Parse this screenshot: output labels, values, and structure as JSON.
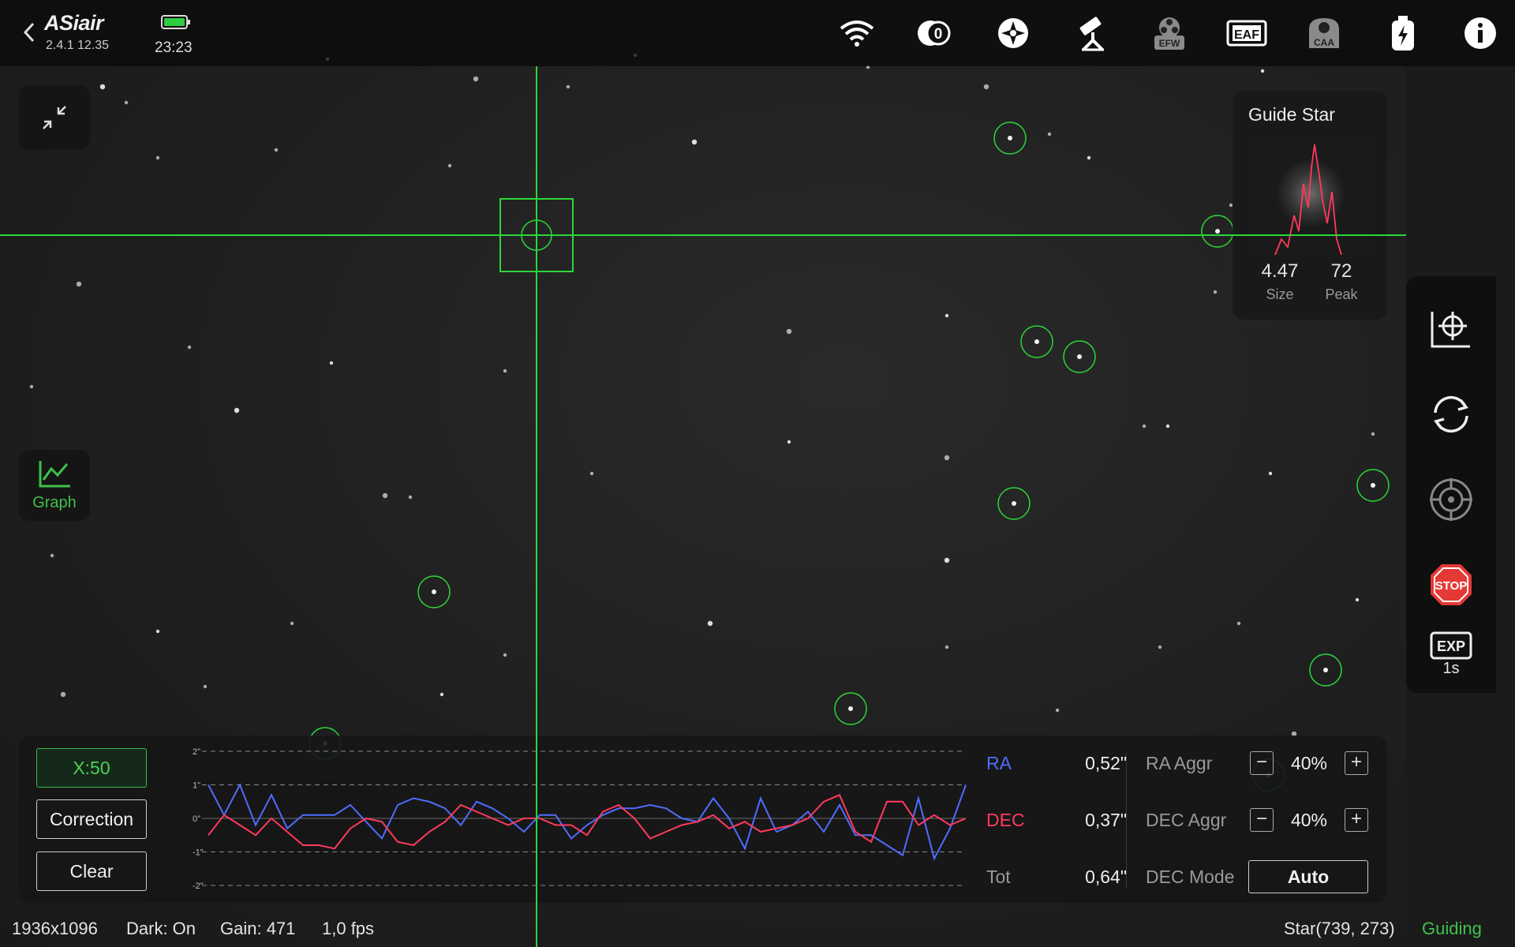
{
  "app": {
    "brand": "ASiair",
    "version": "2.4.1 12.35",
    "time": "23:23"
  },
  "topbar": {
    "icons": [
      "wifi-icon",
      "filter-wheel-zero-icon",
      "focus-target-icon",
      "telescope-mount-icon",
      "efw-icon",
      "eaf-icon",
      "caa-icon",
      "power-usb-icon",
      "info-icon"
    ],
    "efw_label": "EFW",
    "eaf_label": "EAF",
    "caa_label": "CAA",
    "zero_label": "0",
    "colors": {
      "battery": "#2ecc40",
      "inactive": "#8a8a8a"
    }
  },
  "left_buttons": {
    "graph_label": "Graph"
  },
  "guide_star": {
    "title": "Guide Star",
    "size_value": "4.47",
    "size_label": "Size",
    "peak_value": "72",
    "peak_label": "Peak"
  },
  "right_toolbar": {
    "exposure_label": "EXP",
    "exposure_value": "1s",
    "stop_label": "STOP"
  },
  "graph": {
    "x_scale": "X:50",
    "correction_label": "Correction",
    "clear_label": "Clear",
    "y_ticks": [
      "2\"",
      "1\"",
      "0\"",
      "-1\"",
      "-2\""
    ],
    "ra_label": "RA",
    "ra_value": "0,52\"",
    "dec_label": "DEC",
    "dec_value": "0,37\"",
    "tot_label": "Tot",
    "tot_value": "0,64\"",
    "ra_aggr_label": "RA Aggr",
    "ra_aggr_value": "40%",
    "dec_aggr_label": "DEC Aggr",
    "dec_aggr_value": "40%",
    "dec_mode_label": "DEC Mode",
    "dec_mode_value": "Auto",
    "colors": {
      "ra": "#4f6cff",
      "dec": "#ff3a5c"
    }
  },
  "chart_data": {
    "type": "line",
    "title": "",
    "ylim": [
      -2,
      2
    ],
    "y_unit": "arcsec",
    "series": [
      {
        "name": "RA",
        "values": [
          1,
          0.1,
          1,
          -0.2,
          0.7,
          -0.3,
          0.1,
          0.1,
          0.1,
          0.4,
          -0.1,
          -0.6,
          0.4,
          0.6,
          0.5,
          0.3,
          -0.2,
          0.5,
          0.3,
          0,
          -0.4,
          0.1,
          0.1,
          -0.6,
          -0.2,
          0.1,
          0.3,
          0.3,
          0.4,
          0.3,
          0,
          -0.1,
          0.6,
          0,
          -0.9,
          0.6,
          -0.4,
          -0.2,
          0.2,
          -0.4,
          0.4,
          -0.5,
          -0.5,
          -0.8,
          -1.1,
          0.6,
          -1.2,
          -0.3,
          1
        ]
      },
      {
        "name": "DEC",
        "values": [
          -0.5,
          0.1,
          -0.2,
          -0.5,
          0,
          -0.4,
          -0.8,
          -0.8,
          -0.9,
          -0.3,
          0,
          -0.1,
          -0.7,
          -0.8,
          -0.4,
          -0.1,
          0.4,
          0.2,
          0,
          -0.2,
          0,
          0,
          -0.2,
          -0.2,
          -0.5,
          0.2,
          0.4,
          0,
          -0.6,
          -0.4,
          -0.2,
          -0.1,
          0.1,
          -0.3,
          -0.1,
          -0.4,
          -0.3,
          -0.2,
          0,
          0.5,
          0.7,
          -0.4,
          -0.7,
          0.5,
          0.5,
          -0.2,
          0.1,
          -0.2,
          0
        ]
      }
    ]
  },
  "sky_field": {
    "stars": [
      [
        130,
        110
      ],
      [
        160,
        130
      ],
      [
        200,
        200
      ],
      [
        415,
        75
      ],
      [
        603,
        100
      ],
      [
        720,
        110
      ],
      [
        805,
        70
      ],
      [
        1100,
        85
      ],
      [
        1250,
        110
      ],
      [
        1600,
        90
      ],
      [
        350,
        190
      ],
      [
        570,
        210
      ],
      [
        880,
        180
      ],
      [
        1330,
        170
      ],
      [
        1560,
        260
      ],
      [
        1380,
        200
      ],
      [
        100,
        360
      ],
      [
        240,
        440
      ],
      [
        420,
        460
      ],
      [
        640,
        470
      ],
      [
        1000,
        420
      ],
      [
        1200,
        400
      ],
      [
        1540,
        370
      ],
      [
        40,
        490
      ],
      [
        300,
        520
      ],
      [
        520,
        630
      ],
      [
        750,
        600
      ],
      [
        1000,
        560
      ],
      [
        1200,
        580
      ],
      [
        1450,
        540
      ],
      [
        1610,
        600
      ],
      [
        1740,
        550
      ],
      [
        488,
        628
      ],
      [
        200,
        800
      ],
      [
        370,
        790
      ],
      [
        640,
        830
      ],
      [
        900,
        790
      ],
      [
        1200,
        820
      ],
      [
        1570,
        790
      ],
      [
        1720,
        760
      ],
      [
        80,
        880
      ],
      [
        260,
        870
      ],
      [
        560,
        880
      ],
      [
        1340,
        900
      ],
      [
        1640,
        930
      ],
      [
        1480,
        540
      ],
      [
        1470,
        820
      ],
      [
        66,
        704
      ],
      [
        1200,
        710
      ]
    ],
    "circles": [
      [
        1280,
        175
      ],
      [
        1543,
        293
      ],
      [
        1314,
        433
      ],
      [
        1368,
        452
      ],
      [
        1740,
        615
      ],
      [
        1285,
        638
      ],
      [
        550,
        750
      ],
      [
        1680,
        849
      ],
      [
        1078,
        898
      ],
      [
        412,
        942
      ],
      [
        1608,
        982
      ]
    ],
    "crosshair": {
      "x": 680,
      "y": 298
    }
  },
  "status": {
    "resolution": "1936x1096",
    "dark": "Dark: On",
    "gain": "Gain: 471",
    "fps": "1,0 fps",
    "star": "Star(739, 273)",
    "state": "Guiding"
  }
}
